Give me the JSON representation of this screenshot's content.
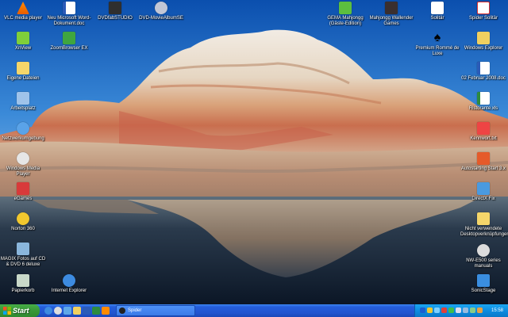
{
  "desktop_icons_left": [
    {
      "label": "VLC media player",
      "icon": "vlc-cone-icon"
    },
    {
      "label": "XnView",
      "icon": "xnview-icon"
    },
    {
      "label": "Eigene Dateien",
      "icon": "folder-icon"
    },
    {
      "label": "Arbeitsplatz",
      "icon": "computer-icon"
    },
    {
      "label": "Netzwerkumgebung",
      "icon": "network-icon"
    },
    {
      "label": "Windows Media Player",
      "icon": "media-player-icon"
    },
    {
      "label": "eGames",
      "icon": "egames-icon"
    },
    {
      "label": "Norton 360",
      "icon": "norton-icon"
    },
    {
      "label": "MAGIX Fotos auf CD & DVD 6 deluxe",
      "icon": "magix-icon"
    },
    {
      "label": "Papierkorb",
      "icon": "recycle-bin-icon"
    }
  ],
  "desktop_icons_col2": [
    {
      "label": "Neu Microsoft Word-Dokument.doc",
      "icon": "word-document-icon"
    },
    {
      "label": "ZoomBrowser EX",
      "icon": "zoombrowser-icon"
    },
    {
      "label": "Internet Explorer",
      "icon": "internet-explorer-icon"
    }
  ],
  "desktop_icons_top_middle": [
    {
      "label": "DVDfabSTUDIO",
      "icon": "dvd-studio-icon"
    },
    {
      "label": "DVD-MovieAlbumSE",
      "icon": "dvd-movie-album-icon"
    }
  ],
  "desktop_icons_right_area": [
    {
      "label": "GEMA Mahjongg (Gäste-Edition)",
      "icon": "mahjongg-icon"
    },
    {
      "label": "Mahjongg Wallender Games",
      "icon": "mahjongg-2-icon"
    },
    {
      "label": "Solitär",
      "icon": "solitaire-icon"
    },
    {
      "label": "Spider Solitär",
      "icon": "spider-solitaire-icon"
    },
    {
      "label": "Premium Rommé de Luxe",
      "icon": "spade-icon"
    }
  ],
  "desktop_icons_right": [
    {
      "label": "Windows Explorer",
      "icon": "windows-explorer-icon"
    },
    {
      "label": "02 Februar 2008.doc",
      "icon": "word-document-icon"
    },
    {
      "label": "Ristorante.xls",
      "icon": "excel-icon"
    },
    {
      "label": "Kennwort.txt",
      "icon": "text-file-icon"
    },
    {
      "label": "Autostarting Start 3.x",
      "icon": "autostart-icon"
    },
    {
      "label": "DirectX Fix",
      "icon": "directx-icon"
    },
    {
      "label": "Nicht verwendete Desktopverknüpfungen",
      "icon": "folder-icon"
    },
    {
      "label": "NW-E500 series manuals",
      "icon": "manual-icon"
    },
    {
      "label": "SonicStage",
      "icon": "sonicstage-icon"
    }
  ],
  "taskbar": {
    "start_label": "Start",
    "active_task": "Spider",
    "clock": "15:58"
  },
  "colors": {
    "taskbar_blue": "#245edb",
    "start_green": "#3b9b3b",
    "tray_blue": "#0e8ce0"
  }
}
